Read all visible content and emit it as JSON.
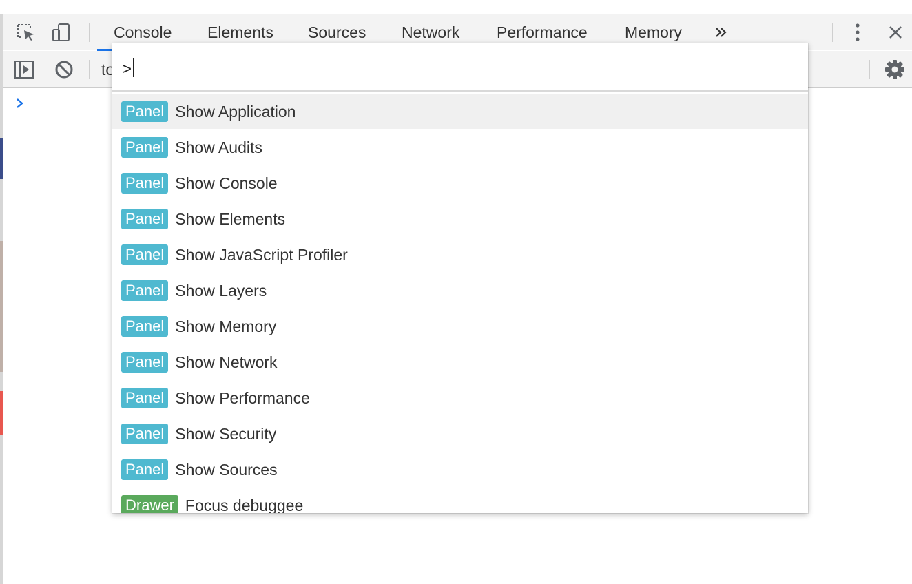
{
  "tabs": [
    {
      "label": "Console",
      "active": true
    },
    {
      "label": "Elements",
      "active": false
    },
    {
      "label": "Sources",
      "active": false
    },
    {
      "label": "Network",
      "active": false
    },
    {
      "label": "Performance",
      "active": false
    },
    {
      "label": "Memory",
      "active": false
    }
  ],
  "toolbar": {
    "context_text": "to",
    "icons": [
      "inspect-element-icon",
      "device-toolbar-icon",
      "more-tabs-icon",
      "kebab-menu-icon",
      "close-icon",
      "sidebar-toggle-icon",
      "clear-console-icon",
      "settings-gear-icon"
    ]
  },
  "console": {
    "prompt_icon": "chevron-right-icon"
  },
  "command_menu": {
    "query": ">",
    "results": [
      {
        "badge": "Panel",
        "label": "Show Application",
        "selected": true
      },
      {
        "badge": "Panel",
        "label": "Show Audits",
        "selected": false
      },
      {
        "badge": "Panel",
        "label": "Show Console",
        "selected": false
      },
      {
        "badge": "Panel",
        "label": "Show Elements",
        "selected": false
      },
      {
        "badge": "Panel",
        "label": "Show JavaScript Profiler",
        "selected": false
      },
      {
        "badge": "Panel",
        "label": "Show Layers",
        "selected": false
      },
      {
        "badge": "Panel",
        "label": "Show Memory",
        "selected": false
      },
      {
        "badge": "Panel",
        "label": "Show Network",
        "selected": false
      },
      {
        "badge": "Panel",
        "label": "Show Performance",
        "selected": false
      },
      {
        "badge": "Panel",
        "label": "Show Security",
        "selected": false
      },
      {
        "badge": "Panel",
        "label": "Show Sources",
        "selected": false
      },
      {
        "badge": "Drawer",
        "label": "Focus debuggee",
        "selected": false
      }
    ]
  },
  "colors": {
    "active_tab_underline": "#1a73e8",
    "panel_badge": "#4fb9d0",
    "drawer_badge": "#5aa95c",
    "prompt_chevron": "#1a73e8",
    "selected_row": "#f0f0f0"
  }
}
